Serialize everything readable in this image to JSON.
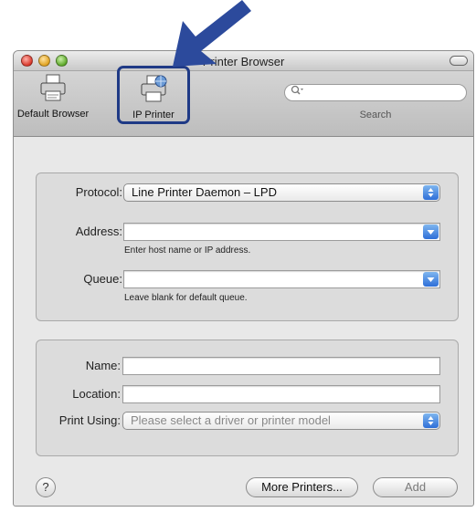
{
  "window": {
    "title": "Printer Browser"
  },
  "toolbar": {
    "default_browser": {
      "label": "Default Browser",
      "icon": "printer-icon"
    },
    "ip_printer": {
      "label": "IP Printer",
      "icon": "network-printer-icon"
    },
    "search": {
      "label": "Search",
      "icon": "magnifier-icon"
    }
  },
  "ip_form": {
    "protocol_label": "Protocol:",
    "protocol_value": "Line Printer Daemon – LPD",
    "address_label": "Address:",
    "address_value": "",
    "address_hint": "Enter host name or IP address.",
    "queue_label": "Queue:",
    "queue_value": "",
    "queue_hint": "Leave blank for default queue."
  },
  "printer_info": {
    "name_label": "Name:",
    "name_value": "",
    "location_label": "Location:",
    "location_value": "",
    "print_using_label": "Print Using:",
    "print_using_value": "Please select a driver or printer model"
  },
  "footer": {
    "help_glyph": "?",
    "more_printers_label": "More Printers...",
    "add_label": "Add"
  },
  "colors": {
    "callout_arrow": "#2c4a9c",
    "highlight_border": "#1f3a86",
    "popup_arrows": "#2e6fd8"
  }
}
